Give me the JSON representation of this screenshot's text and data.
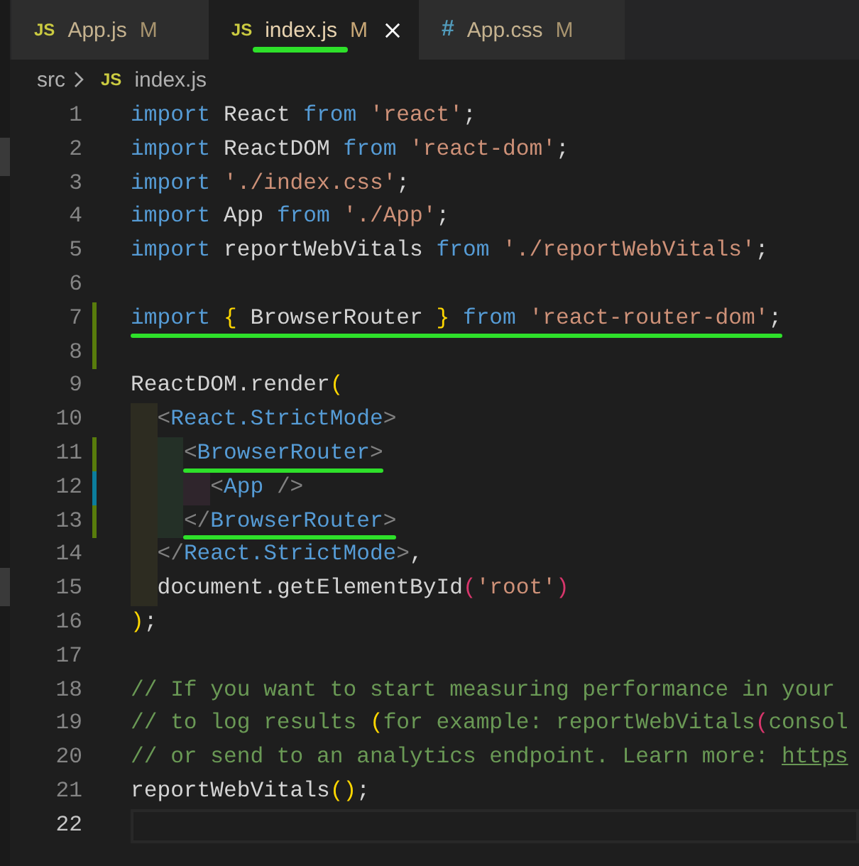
{
  "tabs": [
    {
      "kind": "js",
      "icon": "JS",
      "label": "App.js",
      "status": "M",
      "selected": false,
      "underlined": false
    },
    {
      "kind": "js",
      "icon": "JS",
      "label": "index.js",
      "status": "M",
      "selected": true,
      "underlined": true
    },
    {
      "kind": "css",
      "icon": "#",
      "label": "App.css",
      "status": "M",
      "selected": false,
      "underlined": false
    }
  ],
  "breadcrumb": [
    {
      "kind": "folder",
      "label": "src"
    },
    {
      "kind": "js",
      "icon": "JS",
      "label": "index.js"
    }
  ],
  "editor": {
    "lines": [
      {
        "number": "1",
        "current": false,
        "underlined": false,
        "tokens": [
          {
            "kind": "keyword",
            "text": "import "
          },
          {
            "kind": "plain",
            "text": "React "
          },
          {
            "kind": "keyword",
            "text": "from "
          },
          {
            "kind": "string",
            "text": "'react'"
          },
          {
            "kind": "plain",
            "text": ";"
          }
        ]
      },
      {
        "number": "2",
        "current": false,
        "underlined": false,
        "tokens": [
          {
            "kind": "keyword",
            "text": "import "
          },
          {
            "kind": "plain",
            "text": "ReactDOM "
          },
          {
            "kind": "keyword",
            "text": "from "
          },
          {
            "kind": "string",
            "text": "'react-dom'"
          },
          {
            "kind": "plain",
            "text": ";"
          }
        ]
      },
      {
        "number": "3",
        "current": false,
        "underlined": false,
        "tokens": [
          {
            "kind": "keyword",
            "text": "import "
          },
          {
            "kind": "string",
            "text": "'./index.css'"
          },
          {
            "kind": "plain",
            "text": ";"
          }
        ]
      },
      {
        "number": "4",
        "current": false,
        "underlined": false,
        "tokens": [
          {
            "kind": "keyword",
            "text": "import "
          },
          {
            "kind": "plain",
            "text": "App "
          },
          {
            "kind": "keyword",
            "text": "from "
          },
          {
            "kind": "string",
            "text": "'./App'"
          },
          {
            "kind": "plain",
            "text": ";"
          }
        ]
      },
      {
        "number": "5",
        "current": false,
        "underlined": false,
        "tokens": [
          {
            "kind": "keyword",
            "text": "import "
          },
          {
            "kind": "plain",
            "text": "reportWebVitals "
          },
          {
            "kind": "keyword",
            "text": "from "
          },
          {
            "kind": "string",
            "text": "'./reportWebVitals'"
          },
          {
            "kind": "plain",
            "text": ";"
          }
        ]
      },
      {
        "number": "6",
        "current": false,
        "underlined": false
      },
      {
        "number": "7",
        "current": false,
        "underlined": true,
        "change": {
          "kind": "added"
        },
        "tokens": [
          {
            "kind": "keyword",
            "text": "import "
          },
          {
            "kind": "bracket-outer",
            "text": "{"
          },
          {
            "kind": "plain",
            "text": " BrowserRouter "
          },
          {
            "kind": "bracket-outer",
            "text": "}"
          },
          {
            "kind": "keyword",
            "text": " from "
          },
          {
            "kind": "string",
            "text": "'react-router-dom'"
          },
          {
            "kind": "plain",
            "text": ";"
          }
        ]
      },
      {
        "number": "8",
        "current": false,
        "underlined": false,
        "change": {
          "kind": "added"
        }
      },
      {
        "number": "9",
        "current": false,
        "underlined": false,
        "tokens": [
          {
            "kind": "plain",
            "text": "ReactDOM.render"
          },
          {
            "kind": "bracket-outer",
            "text": "("
          }
        ],
        "children": [
          {
            "number": "10",
            "current": false,
            "underlined": false,
            "tokens": [
              {
                "kind": "tag-bracket",
                "text": "<"
              },
              {
                "kind": "tag",
                "text": "React.StrictMode"
              },
              {
                "kind": "tag-bracket",
                "text": ">"
              }
            ],
            "children": [
              {
                "number": "11",
                "current": false,
                "underlined": true,
                "change": {
                  "kind": "added"
                },
                "tokens": [
                  {
                    "kind": "tag-bracket",
                    "text": "<"
                  },
                  {
                    "kind": "tag",
                    "text": "BrowserRouter"
                  },
                  {
                    "kind": "tag-bracket",
                    "text": ">"
                  }
                ],
                "children": [
                  {
                    "number": "12",
                    "current": false,
                    "underlined": false,
                    "change": {
                      "kind": "modified"
                    },
                    "tokens": [
                      {
                        "kind": "tag-bracket",
                        "text": "<"
                      },
                      {
                        "kind": "tag",
                        "text": "App"
                      },
                      {
                        "kind": "tag-bracket",
                        "text": " />"
                      }
                    ]
                  }
                ]
              },
              {
                "number": "13",
                "current": false,
                "underlined": true,
                "change": {
                  "kind": "added"
                },
                "tokens": [
                  {
                    "kind": "tag-bracket",
                    "text": "</"
                  },
                  {
                    "kind": "tag",
                    "text": "BrowserRouter"
                  },
                  {
                    "kind": "tag-bracket",
                    "text": ">"
                  }
                ]
              }
            ]
          },
          {
            "number": "14",
            "current": false,
            "underlined": false,
            "tokens": [
              {
                "kind": "tag-bracket",
                "text": "</"
              },
              {
                "kind": "tag",
                "text": "React.StrictMode"
              },
              {
                "kind": "tag-bracket",
                "text": ">"
              },
              {
                "kind": "plain",
                "text": ","
              }
            ]
          },
          {
            "number": "15",
            "current": false,
            "underlined": false,
            "tokens": [
              {
                "kind": "plain",
                "text": "document.getElementById"
              },
              {
                "kind": "bracket-inner",
                "text": "("
              },
              {
                "kind": "string",
                "text": "'root'"
              },
              {
                "kind": "bracket-inner",
                "text": ")"
              }
            ]
          }
        ]
      },
      {
        "number": "16",
        "current": false,
        "underlined": false,
        "tokens": [
          {
            "kind": "bracket-outer",
            "text": ")"
          },
          {
            "kind": "plain",
            "text": ";"
          }
        ]
      },
      {
        "number": "17",
        "current": false,
        "underlined": false
      },
      {
        "number": "18",
        "current": false,
        "underlined": false,
        "tokens": [
          {
            "kind": "comment",
            "text": "// If you want to start measuring performance in your"
          }
        ]
      },
      {
        "number": "19",
        "current": false,
        "underlined": false,
        "tokens": [
          {
            "kind": "comment",
            "text": "// to log results "
          },
          {
            "kind": "bracket-outer",
            "text": "("
          },
          {
            "kind": "comment",
            "text": "for example: reportWebVitals"
          },
          {
            "kind": "bracket-inner",
            "text": "("
          },
          {
            "kind": "comment",
            "text": "consol"
          }
        ]
      },
      {
        "number": "20",
        "current": false,
        "underlined": false,
        "tokens": [
          {
            "kind": "comment",
            "text": "// or send to an analytics endpoint. Learn more: "
          },
          {
            "kind": "link",
            "text": "https"
          }
        ]
      },
      {
        "number": "21",
        "current": false,
        "underlined": false,
        "tokens": [
          {
            "kind": "plain",
            "text": "reportWebVitals"
          },
          {
            "kind": "bracket-outer",
            "text": "()"
          },
          {
            "kind": "plain",
            "text": ";"
          }
        ]
      },
      {
        "number": "22",
        "current": true,
        "underlined": false
      }
    ]
  }
}
